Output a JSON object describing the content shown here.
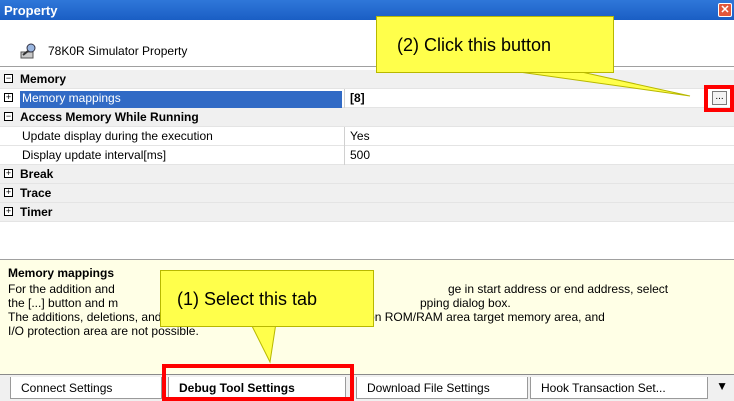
{
  "window": {
    "title": "Property"
  },
  "header": {
    "label": "78K0R Simulator Property",
    "icon": "property-icon"
  },
  "categories": [
    {
      "label": "Memory"
    },
    {
      "label": "Access Memory While Running"
    },
    {
      "label": "Break"
    },
    {
      "label": "Trace"
    },
    {
      "label": "Timer"
    }
  ],
  "rows": [
    {
      "name": "Memory mappings",
      "value": "[8]"
    },
    {
      "name": "Update display during the execution",
      "value": "Yes"
    },
    {
      "name": "Display update interval[ms]",
      "value": "500"
    }
  ],
  "ellipsis": "...",
  "description": {
    "title": "Memory mappings",
    "line1": "For the addition and",
    "line1_end": "ge in start address or end address, select",
    "line2": "the [...] button and m",
    "line2_end": "pping dialog box.",
    "line3": "The additions, deletions, and",
    "line3_end": "other than emulation ROM/RAM area target memory area, and",
    "line4": "I/O protection area are not possible."
  },
  "tabs": [
    {
      "label": "Connect Settings"
    },
    {
      "label": "Debug Tool Settings"
    },
    {
      "label": "Download File Settings"
    },
    {
      "label": "Hook Transaction Set..."
    }
  ],
  "callouts": {
    "top": "(2) Click this button",
    "bottom": "(1) Select this tab"
  },
  "colors": {
    "annotation_red": "#ff0000",
    "callout_yellow": "#ffff4b",
    "selection_blue": "#316ac5"
  }
}
